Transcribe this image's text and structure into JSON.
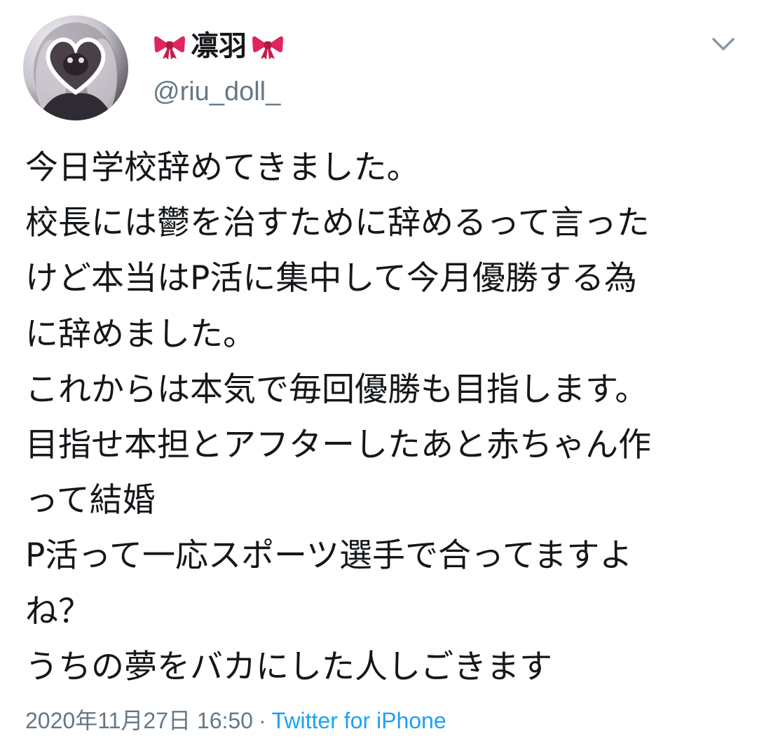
{
  "tweet": {
    "display_name": "凛羽",
    "handle": "@riu_doll_",
    "icons": {
      "avatar": "profile-photo-heart-frame",
      "bow": "red-ribbon-emoji",
      "menu": "chevron-down-icon"
    },
    "body_lines": [
      "今日学校辞めてきました。",
      "校長には鬱を治すために辞めるって言った",
      "けど本当はP活に集中して今月優勝する為",
      "に辞めました。",
      "これからは本気で毎回優勝も目指します。",
      "目指せ本担とアフターしたあと赤ちゃん作",
      "って結婚",
      "P活って一応スポーツ選手で合ってますよ",
      "ね？",
      "うちの夢をバカにした人しごきます"
    ],
    "timestamp": "2020年11月27日 16:50",
    "separator": "·",
    "source": "Twitter for iPhone"
  },
  "colors": {
    "text": "#14171a",
    "secondary": "#657786",
    "link": "#1da1f2",
    "bow": "#e0245e"
  }
}
